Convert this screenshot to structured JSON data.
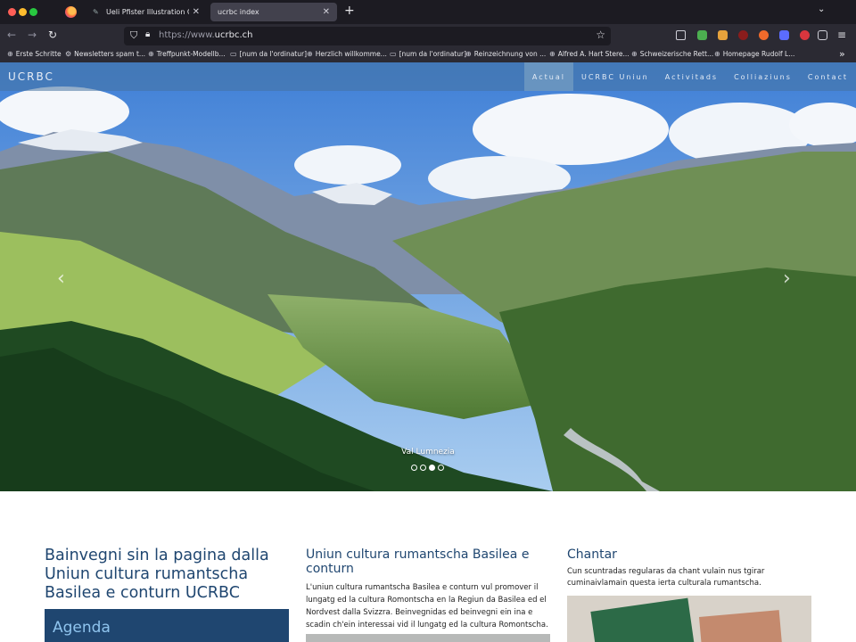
{
  "browser": {
    "tabs": [
      {
        "label": "Ueli Pfister Illustration Comics C",
        "active": false
      },
      {
        "label": "ucrbc index",
        "active": true
      }
    ],
    "url_protocol": "https://www.",
    "url_host": "ucrbc.ch",
    "bookmarks": [
      {
        "label": "Erste Schritte",
        "icon": "globe-icon"
      },
      {
        "label": "Newsletters spam t...",
        "icon": "gear-icon"
      },
      {
        "label": "Treffpunkt-Modellb...",
        "icon": "globe-icon"
      },
      {
        "label": "[num da l'ordinatur]",
        "icon": "folder-icon"
      },
      {
        "label": "Herzlich willkomme...",
        "icon": "globe-icon"
      },
      {
        "label": "[num da l'ordinatur]",
        "icon": "folder-icon"
      },
      {
        "label": "Reinzeichnung von ...",
        "icon": "globe-icon"
      },
      {
        "label": "Alfred A. Hart Stere...",
        "icon": "globe-icon"
      },
      {
        "label": "Schweizerische Rett...",
        "icon": "globe-icon"
      },
      {
        "label": "Homepage Rudolf L...",
        "icon": "globe-icon"
      }
    ]
  },
  "site": {
    "brand": "UCRBC",
    "nav": [
      {
        "label": "Actual",
        "active": true
      },
      {
        "label": "UCRBC Uniun",
        "active": false
      },
      {
        "label": "Activitads",
        "active": false
      },
      {
        "label": "Colliaziuns",
        "active": false
      },
      {
        "label": "Contact",
        "active": false
      }
    ],
    "carousel": {
      "caption": "Val Lumnezia",
      "slide_count": 4,
      "active_index": 2
    },
    "col1": {
      "title": "Bainvegni sin la pagina dalla Uniun cultura rumantscha Basilea e conturn UCRBC",
      "agenda": "Agenda"
    },
    "col2": {
      "title": "Uniun cultura rumantscha Basilea e conturn",
      "text": "L'uniun cultura rumantscha Basilea e conturn vul promover il lungatg ed la cultura Romontscha en la Regiun da Basilea ed el Nordvest dalla Svizzra. Beinvegnidas ed beinvegni ein ina e scadin ch'ein interessai vid il lungatg ed la cultura Romontscha."
    },
    "col3": {
      "title": "Chantar",
      "text": "Cun scuntradas regularas da chant vulain nus tgirar cuminaivlamain questa ierta culturala rumantscha."
    }
  },
  "colors": {
    "heading": "#1f4670",
    "agenda_bg": "#1f4670",
    "agenda_text": "#8fc4ee",
    "nav_overlay": "#4673a0"
  }
}
